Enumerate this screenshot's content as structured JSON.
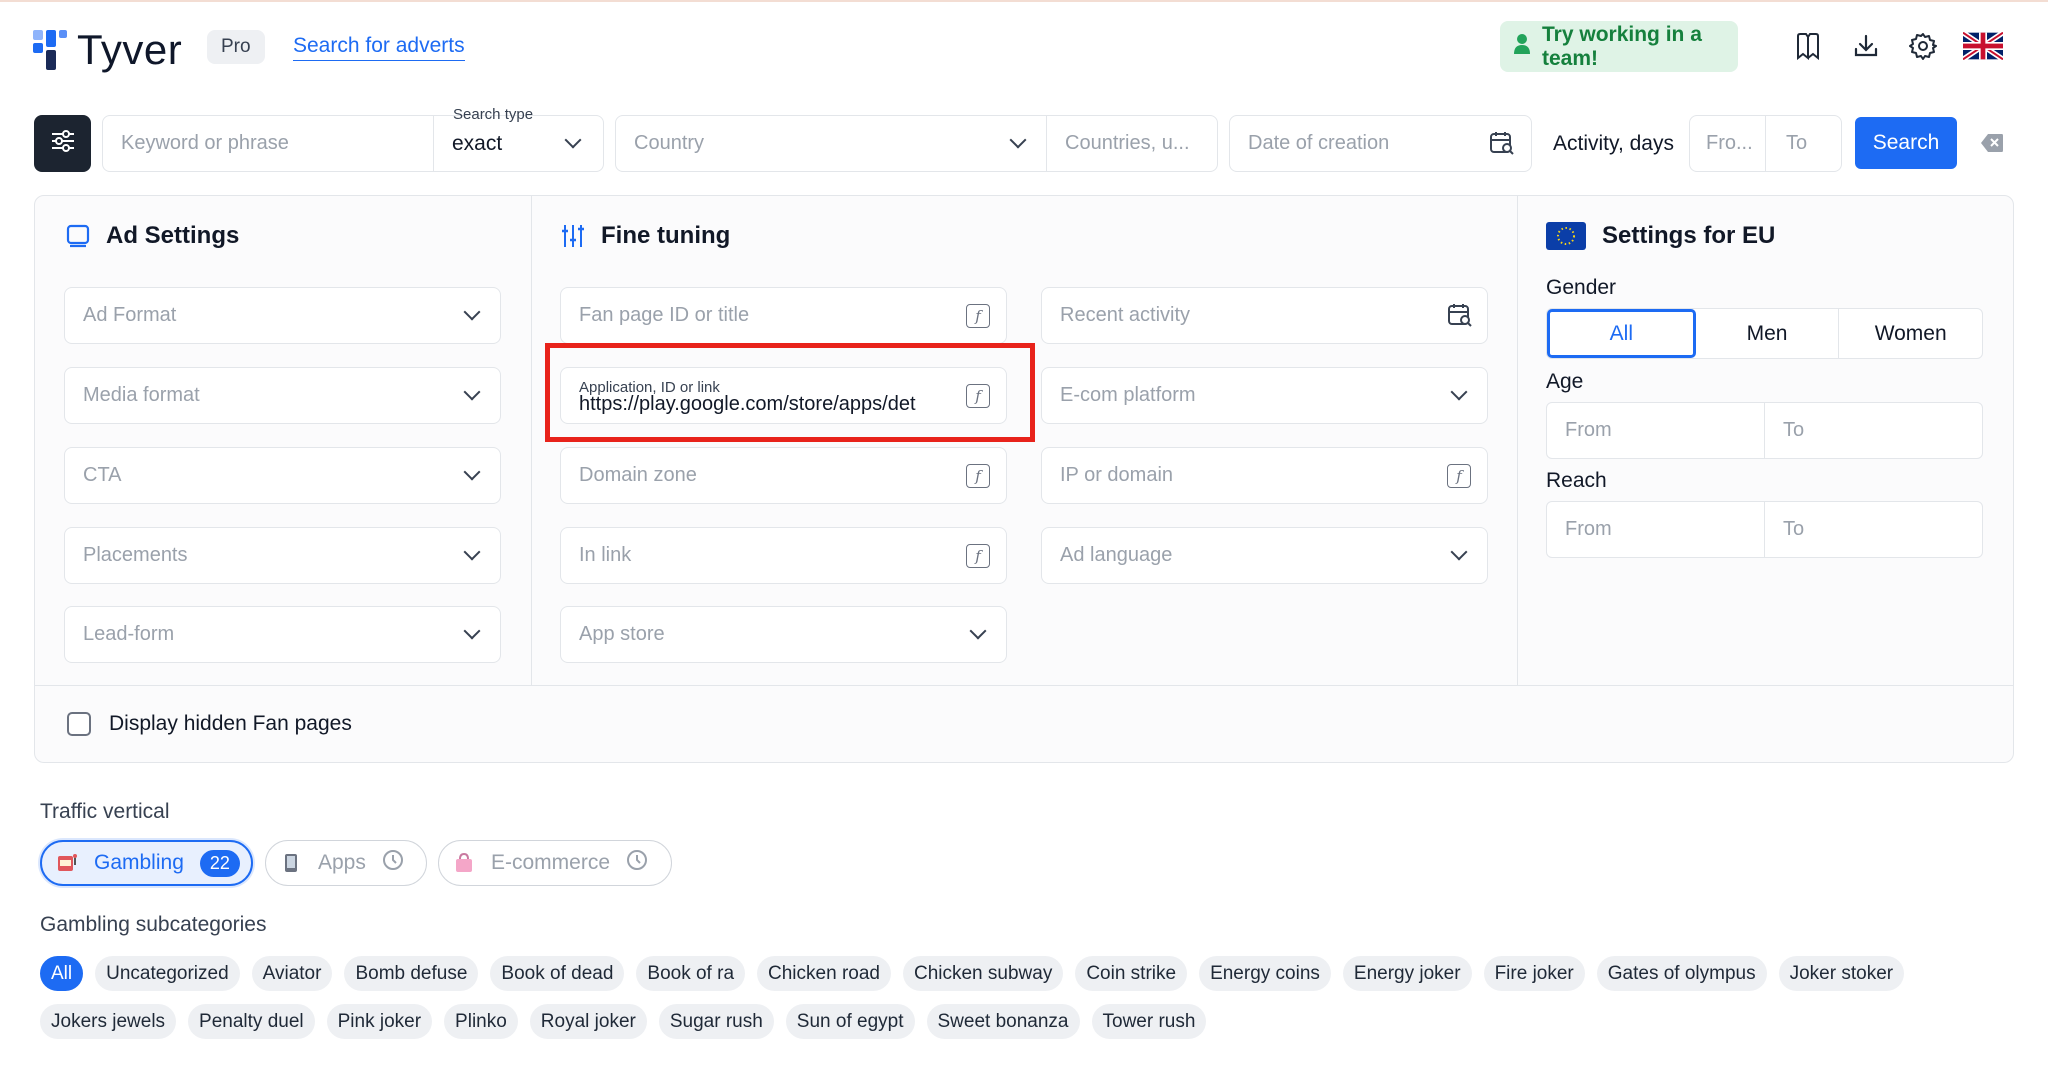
{
  "header": {
    "logo_text": "Tyver",
    "plan_badge": "Pro",
    "nav_link": "Search for adverts",
    "team_button": "Try working in a team!",
    "icons": [
      "bookmark-icon",
      "download-icon",
      "gear-icon",
      "uk-flag-icon"
    ]
  },
  "search_bar": {
    "keyword_placeholder": "Keyword or phrase",
    "search_type_label": "Search type",
    "search_type_value": "exact",
    "country_placeholder": "Country",
    "countries_placeholder": "Countries, u...",
    "date_placeholder": "Date of creation",
    "activity_label": "Activity, days",
    "activity_from_placeholder": "Fro...",
    "activity_to_placeholder": "To",
    "search_button": "Search"
  },
  "ad_settings": {
    "title": "Ad Settings",
    "fields": [
      "Ad Format",
      "Media format",
      "CTA",
      "Placements",
      "Lead-form"
    ]
  },
  "fine_tuning": {
    "title": "Fine tuning",
    "fan_page": "Fan page ID or title",
    "application_label": "Application, ID or link",
    "application_value": "https://play.google.com/store/apps/det",
    "domain_zone": "Domain zone",
    "in_link": "In link",
    "app_store": "App store",
    "recent_activity": "Recent activity",
    "ecom_platform": "E-com platform",
    "ip_domain": "IP or domain",
    "ad_language": "Ad language"
  },
  "eu_settings": {
    "title": "Settings for EU",
    "gender_label": "Gender",
    "gender_options": [
      "All",
      "Men",
      "Women"
    ],
    "gender_selected": "All",
    "age_label": "Age",
    "age_from": "From",
    "age_to": "To",
    "reach_label": "Reach",
    "reach_from": "From",
    "reach_to": "To"
  },
  "hidden_fanpages_label": "Display hidden Fan pages",
  "traffic": {
    "label": "Traffic vertical",
    "gambling": "Gambling",
    "gambling_count": "22",
    "apps": "Apps",
    "ecommerce": "E-commerce"
  },
  "subcategories": {
    "label": "Gambling subcategories",
    "items": [
      "All",
      "Uncategorized",
      "Aviator",
      "Bomb defuse",
      "Book of dead",
      "Book of ra",
      "Chicken road",
      "Chicken subway",
      "Coin strike",
      "Energy coins",
      "Energy joker",
      "Fire joker",
      "Gates of olympus",
      "Joker stoker",
      "Jokers jewels",
      "Penalty duel",
      "Pink joker",
      "Plinko",
      "Royal joker",
      "Sugar rush",
      "Sun of egypt",
      "Sweet bonanza",
      "Tower rush"
    ],
    "selected": "All"
  },
  "colors": {
    "accent": "#1d6bf3",
    "highlight": "#e8231b",
    "team_bg": "#dff3e6",
    "team_text": "#15803d"
  }
}
